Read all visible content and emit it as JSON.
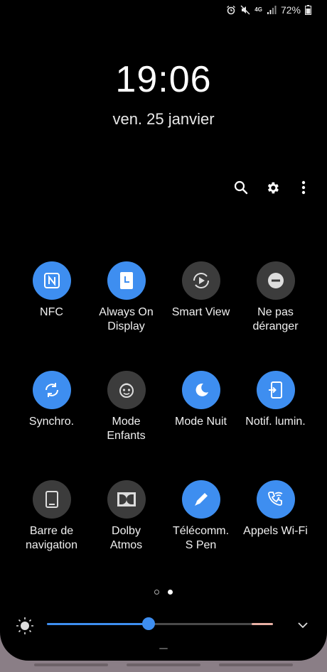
{
  "status_bar": {
    "network": "4G",
    "battery": "72%",
    "icons": [
      "alarm-icon",
      "mute-icon",
      "network-4g-icon",
      "signal-icon",
      "battery-icon"
    ]
  },
  "clock": {
    "time": "19:06",
    "date": "ven. 25 janvier"
  },
  "toolbar": {
    "icons": [
      "search-icon",
      "settings-gear-icon",
      "more-options-icon"
    ]
  },
  "tiles": [
    {
      "label": "NFC",
      "icon": "nfc-icon",
      "on": true
    },
    {
      "label": "Always On\nDisplay",
      "icon": "always-on-display-icon",
      "on": true
    },
    {
      "label": "Smart View",
      "icon": "smart-view-icon",
      "on": false
    },
    {
      "label": "Ne pas\ndéranger",
      "icon": "do-not-disturb-icon",
      "on": false
    },
    {
      "label": "Synchro.",
      "icon": "sync-icon",
      "on": true
    },
    {
      "label": "Mode\nEnfants",
      "icon": "kids-mode-icon",
      "on": false
    },
    {
      "label": "Mode Nuit",
      "icon": "night-mode-moon-icon",
      "on": true
    },
    {
      "label": "Notif. lumin.",
      "icon": "edge-lighting-icon",
      "on": true
    },
    {
      "label": "Barre de\nnavigation",
      "icon": "navigation-bar-icon",
      "on": false
    },
    {
      "label": "Dolby\nAtmos",
      "icon": "dolby-icon",
      "on": false
    },
    {
      "label": "Télécomm.\nS Pen",
      "icon": "s-pen-remote-icon",
      "on": true
    },
    {
      "label": "Appels Wi-Fi",
      "icon": "wifi-calling-icon",
      "on": true
    }
  ],
  "pages": {
    "count": 2,
    "current": 2
  },
  "brightness": {
    "level": 0.45,
    "icon": "brightness-sun-icon"
  },
  "colors": {
    "accent": "#3e8ef0",
    "tile_off": "#3c3c3c",
    "background": "#000000"
  }
}
